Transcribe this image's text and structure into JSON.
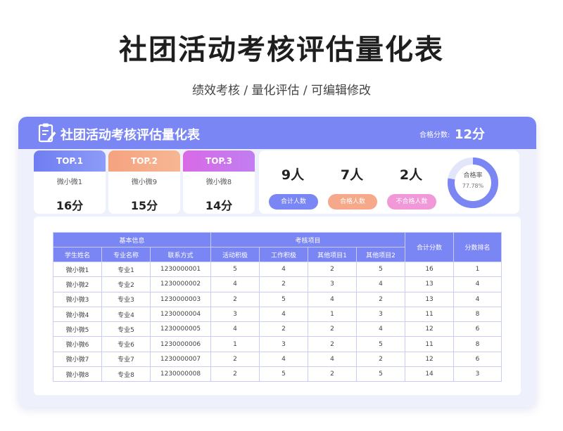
{
  "page": {
    "title": "社团活动考核评估量化表",
    "subtitle": "绩效考核 / 量化评估 /  可编辑修改"
  },
  "header": {
    "title": "社团活动考核评估量化表",
    "score_label": "合格分数:",
    "score_value": "12分"
  },
  "top": [
    {
      "label": "TOP.1",
      "name": "微小微1",
      "score": "16分",
      "color": "#6f7df2"
    },
    {
      "label": "TOP.2",
      "name": "微小微9",
      "score": "15分",
      "color": "#f5a27f"
    },
    {
      "label": "TOP.3",
      "name": "微小微8",
      "score": "14分",
      "color": "#d96ae6"
    }
  ],
  "stats": [
    {
      "value": "9人",
      "label": "合计人数",
      "color": "#7b86f5"
    },
    {
      "value": "7人",
      "label": "合格人数",
      "color": "#f5a98a"
    },
    {
      "value": "2人",
      "label": "不合格人数",
      "color": "#f199d8"
    }
  ],
  "pass_rate": {
    "label": "合格率",
    "value": "77.78%",
    "fraction": 0.7778
  },
  "table": {
    "group_headers": [
      "基本信息",
      "考核项目",
      "合计分数",
      "分数排名"
    ],
    "columns": [
      "学生姓名",
      "专业名称",
      "联系方式",
      "活动积极",
      "工作积极",
      "其他项目1",
      "其他项目2"
    ],
    "rows": [
      [
        "微小微1",
        "专业1",
        "1230000001",
        "5",
        "4",
        "2",
        "5",
        "16",
        "1"
      ],
      [
        "微小微2",
        "专业2",
        "1230000002",
        "4",
        "2",
        "3",
        "4",
        "13",
        "4"
      ],
      [
        "微小微3",
        "专业3",
        "1230000003",
        "2",
        "5",
        "4",
        "2",
        "13",
        "4"
      ],
      [
        "微小微4",
        "专业4",
        "1230000004",
        "3",
        "4",
        "1",
        "3",
        "11",
        "8"
      ],
      [
        "微小微5",
        "专业5",
        "1230000005",
        "4",
        "2",
        "2",
        "4",
        "12",
        "6"
      ],
      [
        "微小微6",
        "专业6",
        "1230000006",
        "1",
        "3",
        "2",
        "5",
        "11",
        "8"
      ],
      [
        "微小微7",
        "专业7",
        "1230000007",
        "2",
        "4",
        "4",
        "2",
        "12",
        "6"
      ],
      [
        "微小微8",
        "专业8",
        "1230000008",
        "2",
        "5",
        "2",
        "5",
        "14",
        "3"
      ]
    ]
  }
}
